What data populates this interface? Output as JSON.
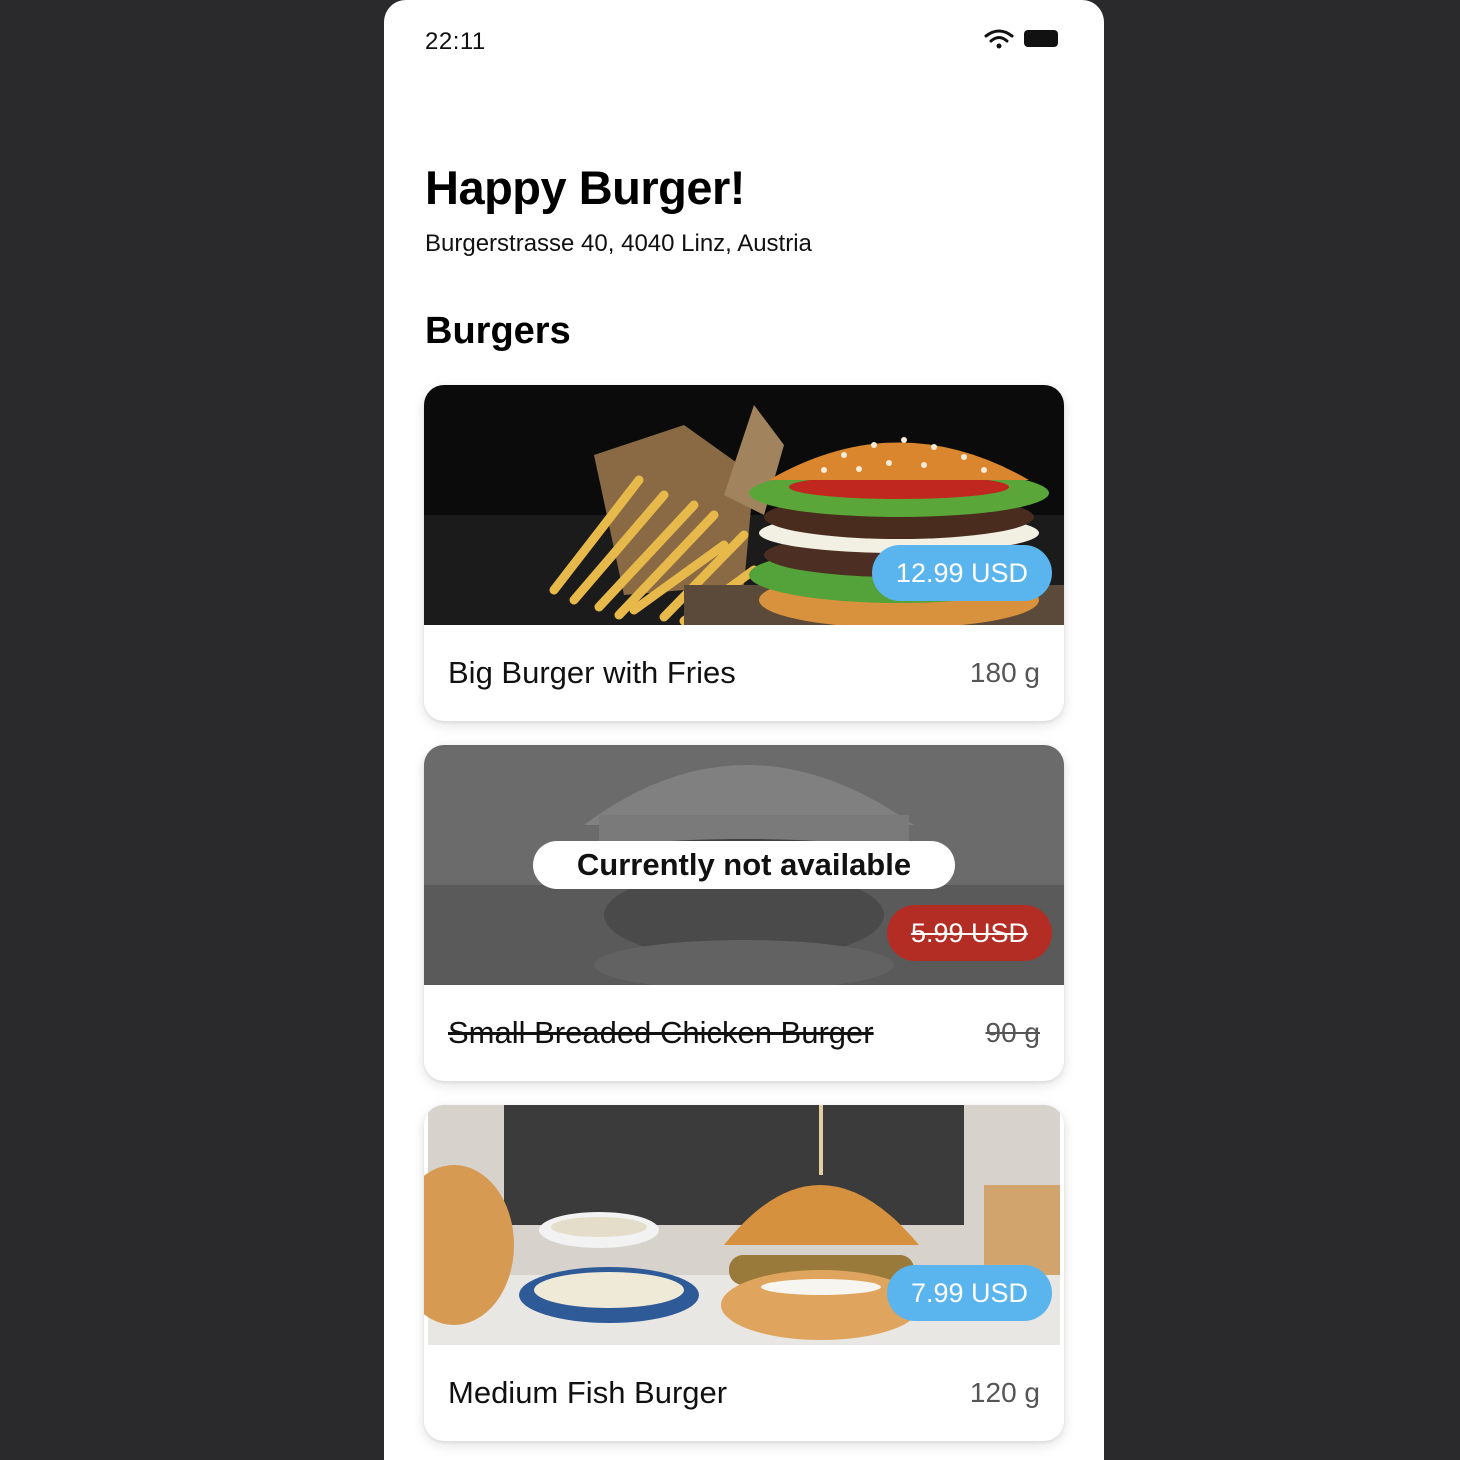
{
  "status_bar": {
    "time": "22:11"
  },
  "header": {
    "title": "Happy Burger!",
    "address": "Burgerstrasse 40, 4040 Linz, Austria"
  },
  "section": {
    "title": "Burgers"
  },
  "items": [
    {
      "name": "Big Burger with Fries",
      "weight": "180 g",
      "price": "12.99 USD",
      "available": true
    },
    {
      "name": "Small Breaded Chicken Burger",
      "weight": "90 g",
      "price": "5.99 USD",
      "available": false,
      "unavailable_label": "Currently not available"
    },
    {
      "name": "Medium Fish Burger",
      "weight": "120 g",
      "price": "7.99 USD",
      "available": true
    }
  ],
  "colors": {
    "available_price": "#5ab5ee",
    "unavailable_price": "#b42d25",
    "background": "#2a2a2c"
  }
}
